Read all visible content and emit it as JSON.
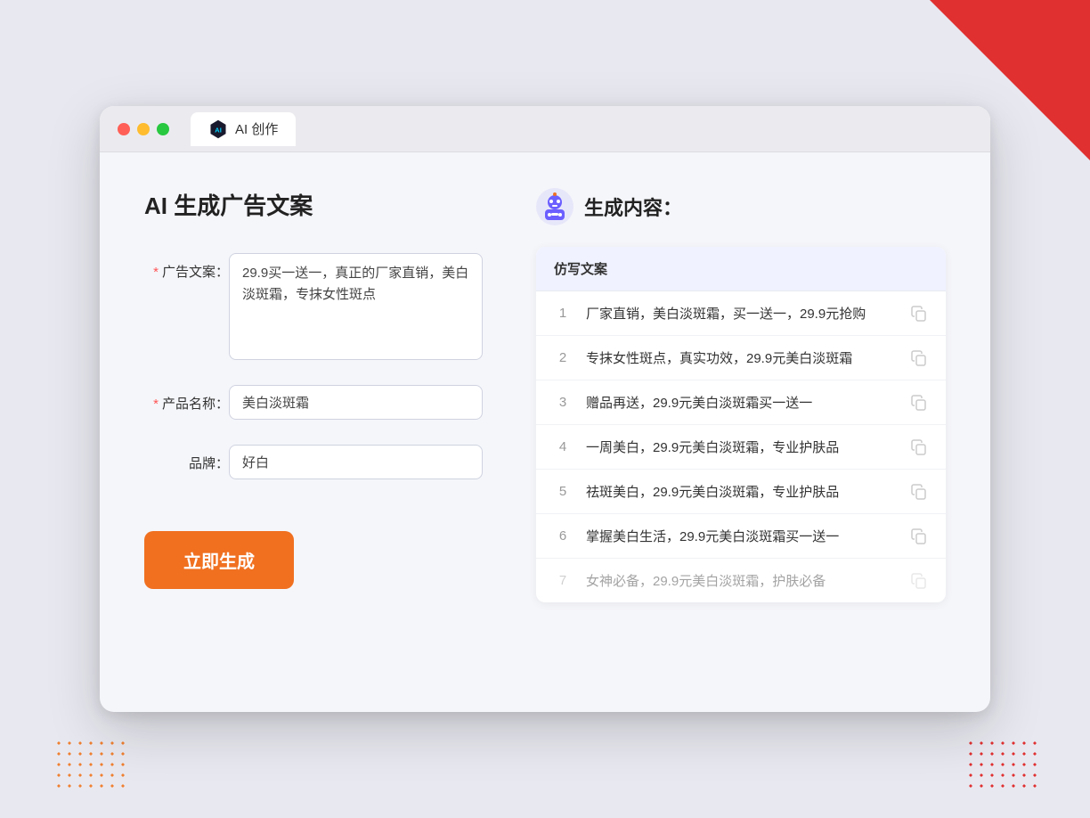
{
  "window": {
    "tab_title": "AI 创作"
  },
  "left_panel": {
    "title": "AI 生成广告文案",
    "fields": {
      "ad_copy_label": "广告文案：",
      "ad_copy_value": "29.9买一送一，真正的厂家直销，美白淡斑霜，专抹女性斑点",
      "product_name_label": "产品名称：",
      "product_name_value": "美白淡斑霜",
      "brand_label": "品牌：",
      "brand_value": "好白"
    },
    "generate_button": "立即生成"
  },
  "right_panel": {
    "title": "生成内容：",
    "table_header": "仿写文案",
    "results": [
      {
        "num": 1,
        "text": "厂家直销，美白淡斑霜，买一送一，29.9元抢购"
      },
      {
        "num": 2,
        "text": "专抹女性斑点，真实功效，29.9元美白淡斑霜"
      },
      {
        "num": 3,
        "text": "赠品再送，29.9元美白淡斑霜买一送一"
      },
      {
        "num": 4,
        "text": "一周美白，29.9元美白淡斑霜，专业护肤品"
      },
      {
        "num": 5,
        "text": "祛斑美白，29.9元美白淡斑霜，专业护肤品"
      },
      {
        "num": 6,
        "text": "掌握美白生活，29.9元美白淡斑霜买一送一"
      },
      {
        "num": 7,
        "text": "女神必备，29.9元美白淡斑霜，护肤必备",
        "dimmed": true
      }
    ]
  }
}
